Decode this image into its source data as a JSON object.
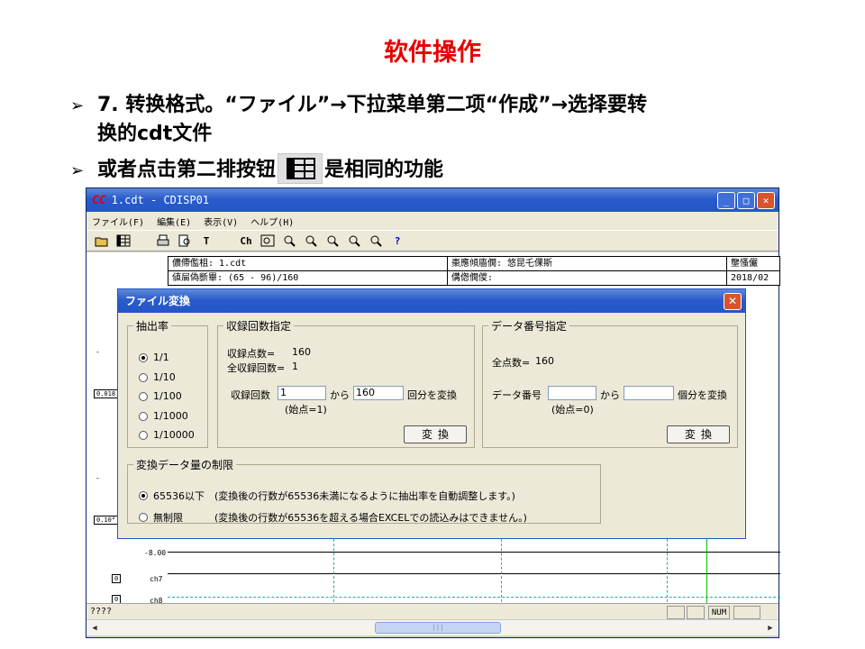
{
  "slide": {
    "title": "软件操作",
    "bullets": [
      {
        "marker": "➢",
        "line1": "7. 转换格式。“ファイル”→下拉菜单第二项“作成”→选择要转",
        "line2": "换的cdt文件"
      },
      {
        "marker": "➢",
        "before": "或者点击第二排按钮",
        "after": "是相同的功能"
      }
    ]
  },
  "window": {
    "title": "1.cdt - CDISP01",
    "logo": "CC",
    "controls": {
      "minimize": "_",
      "maximize": "□",
      "close": "✕"
    },
    "menu": [
      "ファイル(F)",
      "編集(E)",
      "表示(V)",
      "ヘルプ(H)"
    ],
    "toolbar_text_items": {
      "text_tool": "T",
      "channel_tool": "Ch",
      "help_tool": "?"
    },
    "header_rows": [
      [
        "儂僀儖柤: 1.cdt",
        "棗應傾廧僩: 悠昆乇倮斯",
        "壟慅儼"
      ],
      [
        "値屇偽斵畢: (65 - 96)/160",
        "傋偬僩儍:",
        "2018/02"
      ]
    ],
    "axis_labels": [
      "-8.00",
      "ch7",
      "ch8"
    ],
    "side_values": [
      "0.018",
      "0.10°"
    ],
    "status": {
      "left": "????",
      "num": "NUM",
      "scroll_thumb": "|||"
    }
  },
  "dialog": {
    "title": "ファイル変換",
    "close": "✕",
    "rate_group": {
      "legend": "抽出率",
      "options": [
        "1/1",
        "1/10",
        "1/100",
        "1/1000",
        "1/10000"
      ],
      "selected_index": 0
    },
    "record_group": {
      "legend": "収録回数指定",
      "points_label": "収録点数=",
      "points_value": "160",
      "total_label": "全収録回数=",
      "total_value": "1",
      "count_label": "収録回数",
      "from_value": "1",
      "kara": "から",
      "to_value": "160",
      "suffix": "回分を変換",
      "hint": "(始点=1)",
      "button": "変換"
    },
    "data_group": {
      "legend": "データ番号指定",
      "points_label": "全点数=",
      "points_value": "160",
      "num_label": "データ番号",
      "from_value": "",
      "kara": "から",
      "to_value": "",
      "suffix": "個分を変換",
      "hint": "(始点=0)",
      "button": "変換"
    },
    "limit_group": {
      "legend": "変換データ量の制限",
      "options": [
        {
          "label": "65536以下",
          "desc": "(変換後の行数が65536未満になるように抽出率を自動調整します。)"
        },
        {
          "label": "無制限",
          "desc": "(変換後の行数が65536を超える場合EXCELでの読込みはできません。)"
        }
      ],
      "selected_index": 0
    }
  }
}
